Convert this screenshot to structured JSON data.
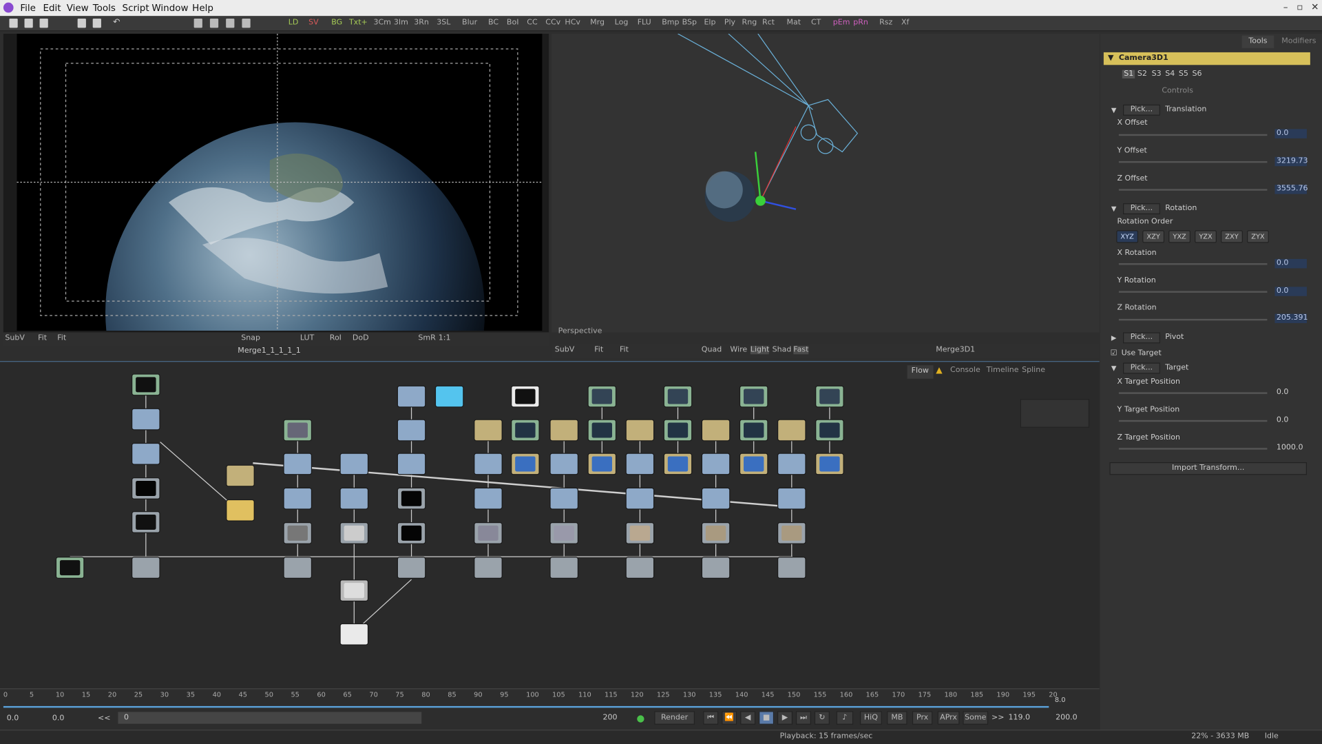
{
  "menu": [
    "File",
    "Edit",
    "View",
    "Tools",
    "Script",
    "Window",
    "Help"
  ],
  "toolbar_tools": [
    "LD",
    "SV",
    "BG",
    "Txt+",
    "3Cm",
    "3Im",
    "3Rn",
    "3SL",
    "Blur",
    "BC",
    "BoI",
    "CC",
    "CCv",
    "HCv",
    "Mrg",
    "Log",
    "FLU",
    "Bmp",
    "BSp",
    "Elp",
    "Ply",
    "Rng",
    "Rct",
    "Mat",
    "CT",
    "pEm",
    "pRn",
    "Rsz",
    "Xf"
  ],
  "viewer1": {
    "controls": [
      "SubV",
      "Fit",
      "Fit",
      "Snap",
      "LUT",
      "RoI",
      "DoD",
      "SmR",
      "1:1"
    ],
    "node_name": "Merge1_1_1_1_1"
  },
  "viewer2": {
    "label": "Perspective",
    "controls": [
      "SubV",
      "Fit",
      "Fit",
      "Quad",
      "Wire",
      "Light",
      "Shad",
      "Fast"
    ],
    "node_name": "Merge3D1"
  },
  "flow_tabs": [
    "Flow",
    "Console",
    "Timeline",
    "Spline"
  ],
  "right_panel": {
    "tabs": [
      "Tools",
      "Modifiers"
    ],
    "tool_name": "Camera3D1",
    "slots": [
      "S1",
      "S2",
      "S3",
      "S4",
      "S5",
      "S6"
    ],
    "controls_label": "Controls",
    "pick": "Pick...",
    "sections": {
      "translation": "Translation",
      "rotation": "Rotation",
      "pivot": "Pivot",
      "target": "Target"
    },
    "x_offset": {
      "label": "X Offset",
      "value": "0.0"
    },
    "y_offset": {
      "label": "Y Offset",
      "value": "3219.73"
    },
    "z_offset": {
      "label": "Z Offset",
      "value": "3555.76"
    },
    "rotation_order_label": "Rotation Order",
    "rotation_orders": [
      "XYZ",
      "XZY",
      "YXZ",
      "YZX",
      "ZXY",
      "ZYX"
    ],
    "x_rotation": {
      "label": "X Rotation",
      "value": "0.0"
    },
    "y_rotation": {
      "label": "Y Rotation",
      "value": "0.0"
    },
    "z_rotation": {
      "label": "Z Rotation",
      "value": "205.391"
    },
    "use_target": "Use Target",
    "x_target": {
      "label": "X Target Position",
      "value": "0.0"
    },
    "y_target": {
      "label": "Y Target Position",
      "value": "0.0"
    },
    "z_target": {
      "label": "Z Target Position",
      "value": "1000.0"
    },
    "import_btn": "Import Transform..."
  },
  "timeline": {
    "ticks": [
      "0",
      "5",
      "10",
      "15",
      "20",
      "25",
      "30",
      "35",
      "40",
      "45",
      "50",
      "55",
      "60",
      "65",
      "70",
      "75",
      "80",
      "85",
      "90",
      "95",
      "100",
      "105",
      "110",
      "115",
      "120",
      "125",
      "130",
      "135",
      "140",
      "145",
      "150",
      "155",
      "160",
      "165",
      "170",
      "175",
      "180",
      "185",
      "190",
      "195",
      "20"
    ],
    "end_label": "8.0",
    "start_a": "0.0",
    "start_b": "0.0",
    "range_lbl": "<<",
    "range_start": "0",
    "range_end": "200",
    "render": "Render",
    "hiq": "HiQ",
    "mb": "MB",
    "prx": "Prx",
    "aprx": "APrx",
    "some": "Some",
    "ff": ">>",
    "current": "119.0",
    "end": "200.0"
  },
  "status": {
    "playback": "Playback: 15 frames/sec",
    "memory": "22% - 3633 MB",
    "state": "Idle"
  }
}
